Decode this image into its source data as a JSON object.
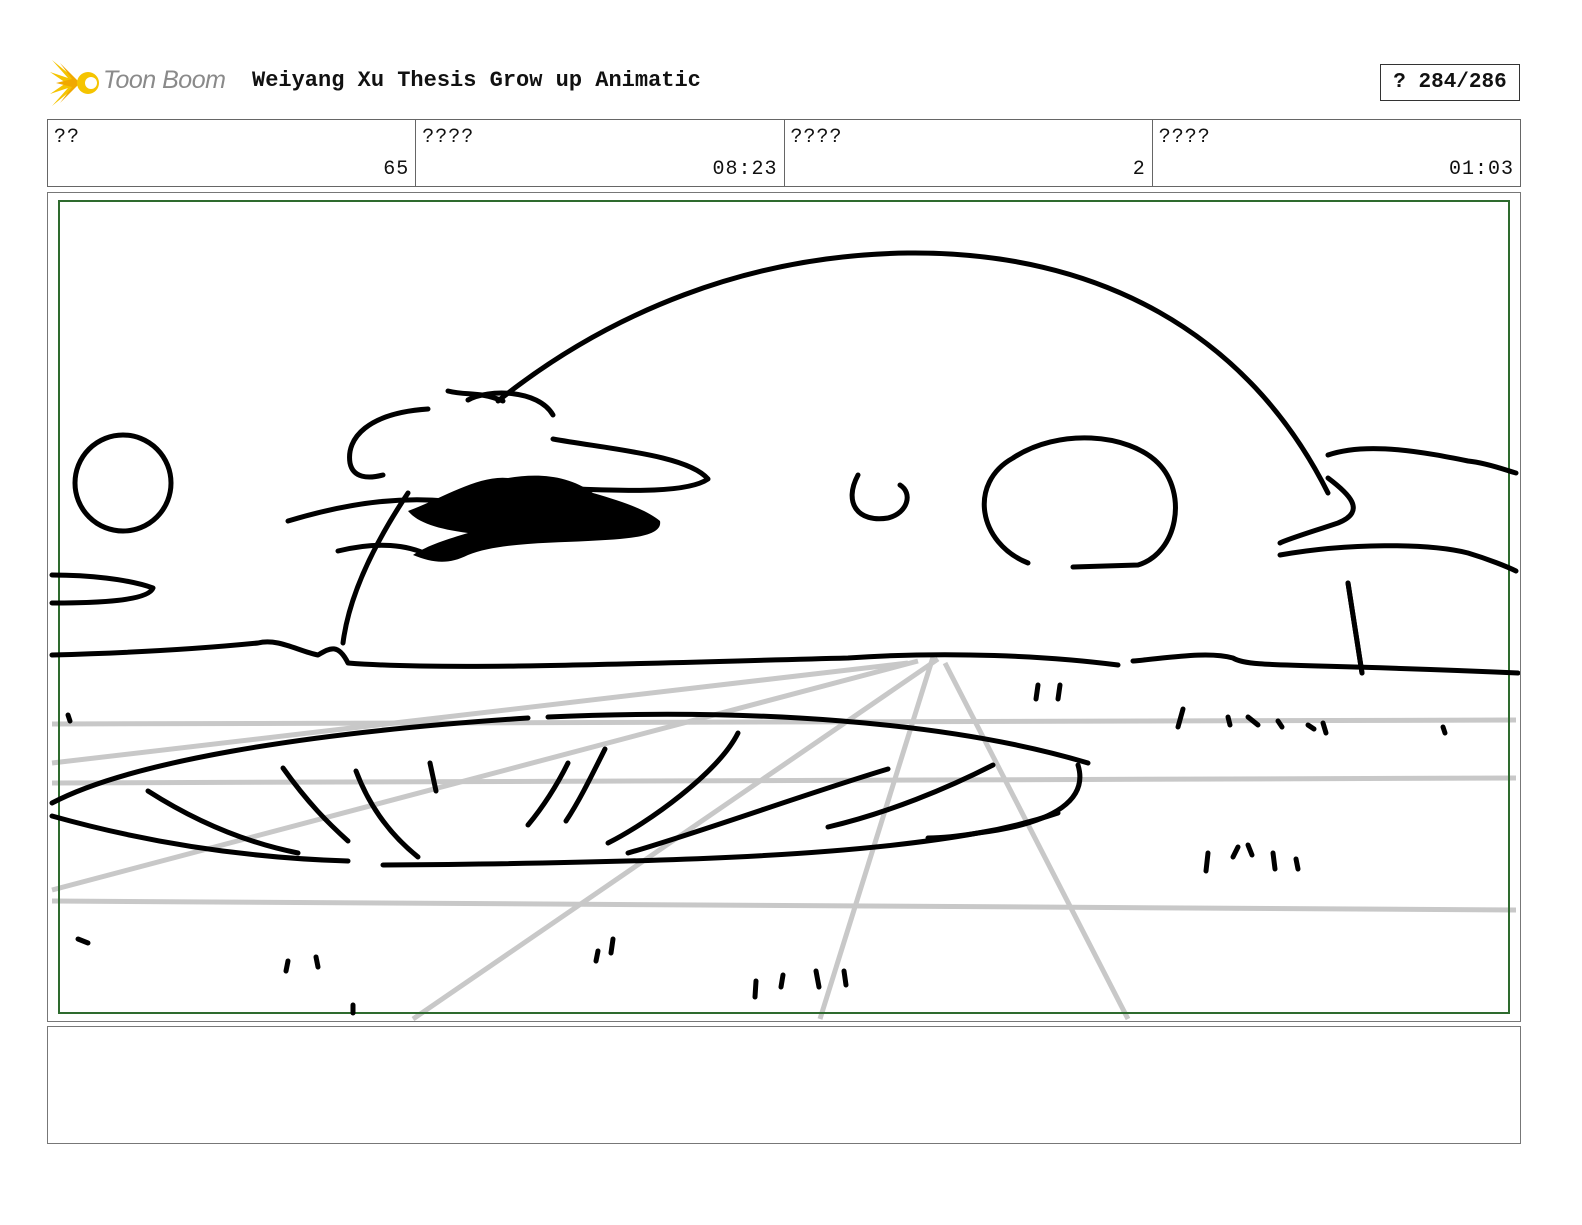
{
  "header": {
    "logo_text": "Toon Boom",
    "project_title": "Weiyang Xu Thesis Grow up Animatic",
    "page_counter": "? 284/286",
    "logo_colors": {
      "flame_primary": "#f5c400",
      "flame_secondary": "#f0a800",
      "text": "#8a8a8a"
    }
  },
  "info_cells": [
    {
      "label": "??",
      "value": "65"
    },
    {
      "label": "????",
      "value": "08:23"
    },
    {
      "label": "????",
      "value": "2"
    },
    {
      "label": "????",
      "value": "01:03"
    }
  ],
  "panel": {
    "safe_frame_color": "#2e6b2e",
    "ink_color": "#000000",
    "guide_color": "#c8c8c8"
  },
  "notes": {
    "text": ""
  }
}
